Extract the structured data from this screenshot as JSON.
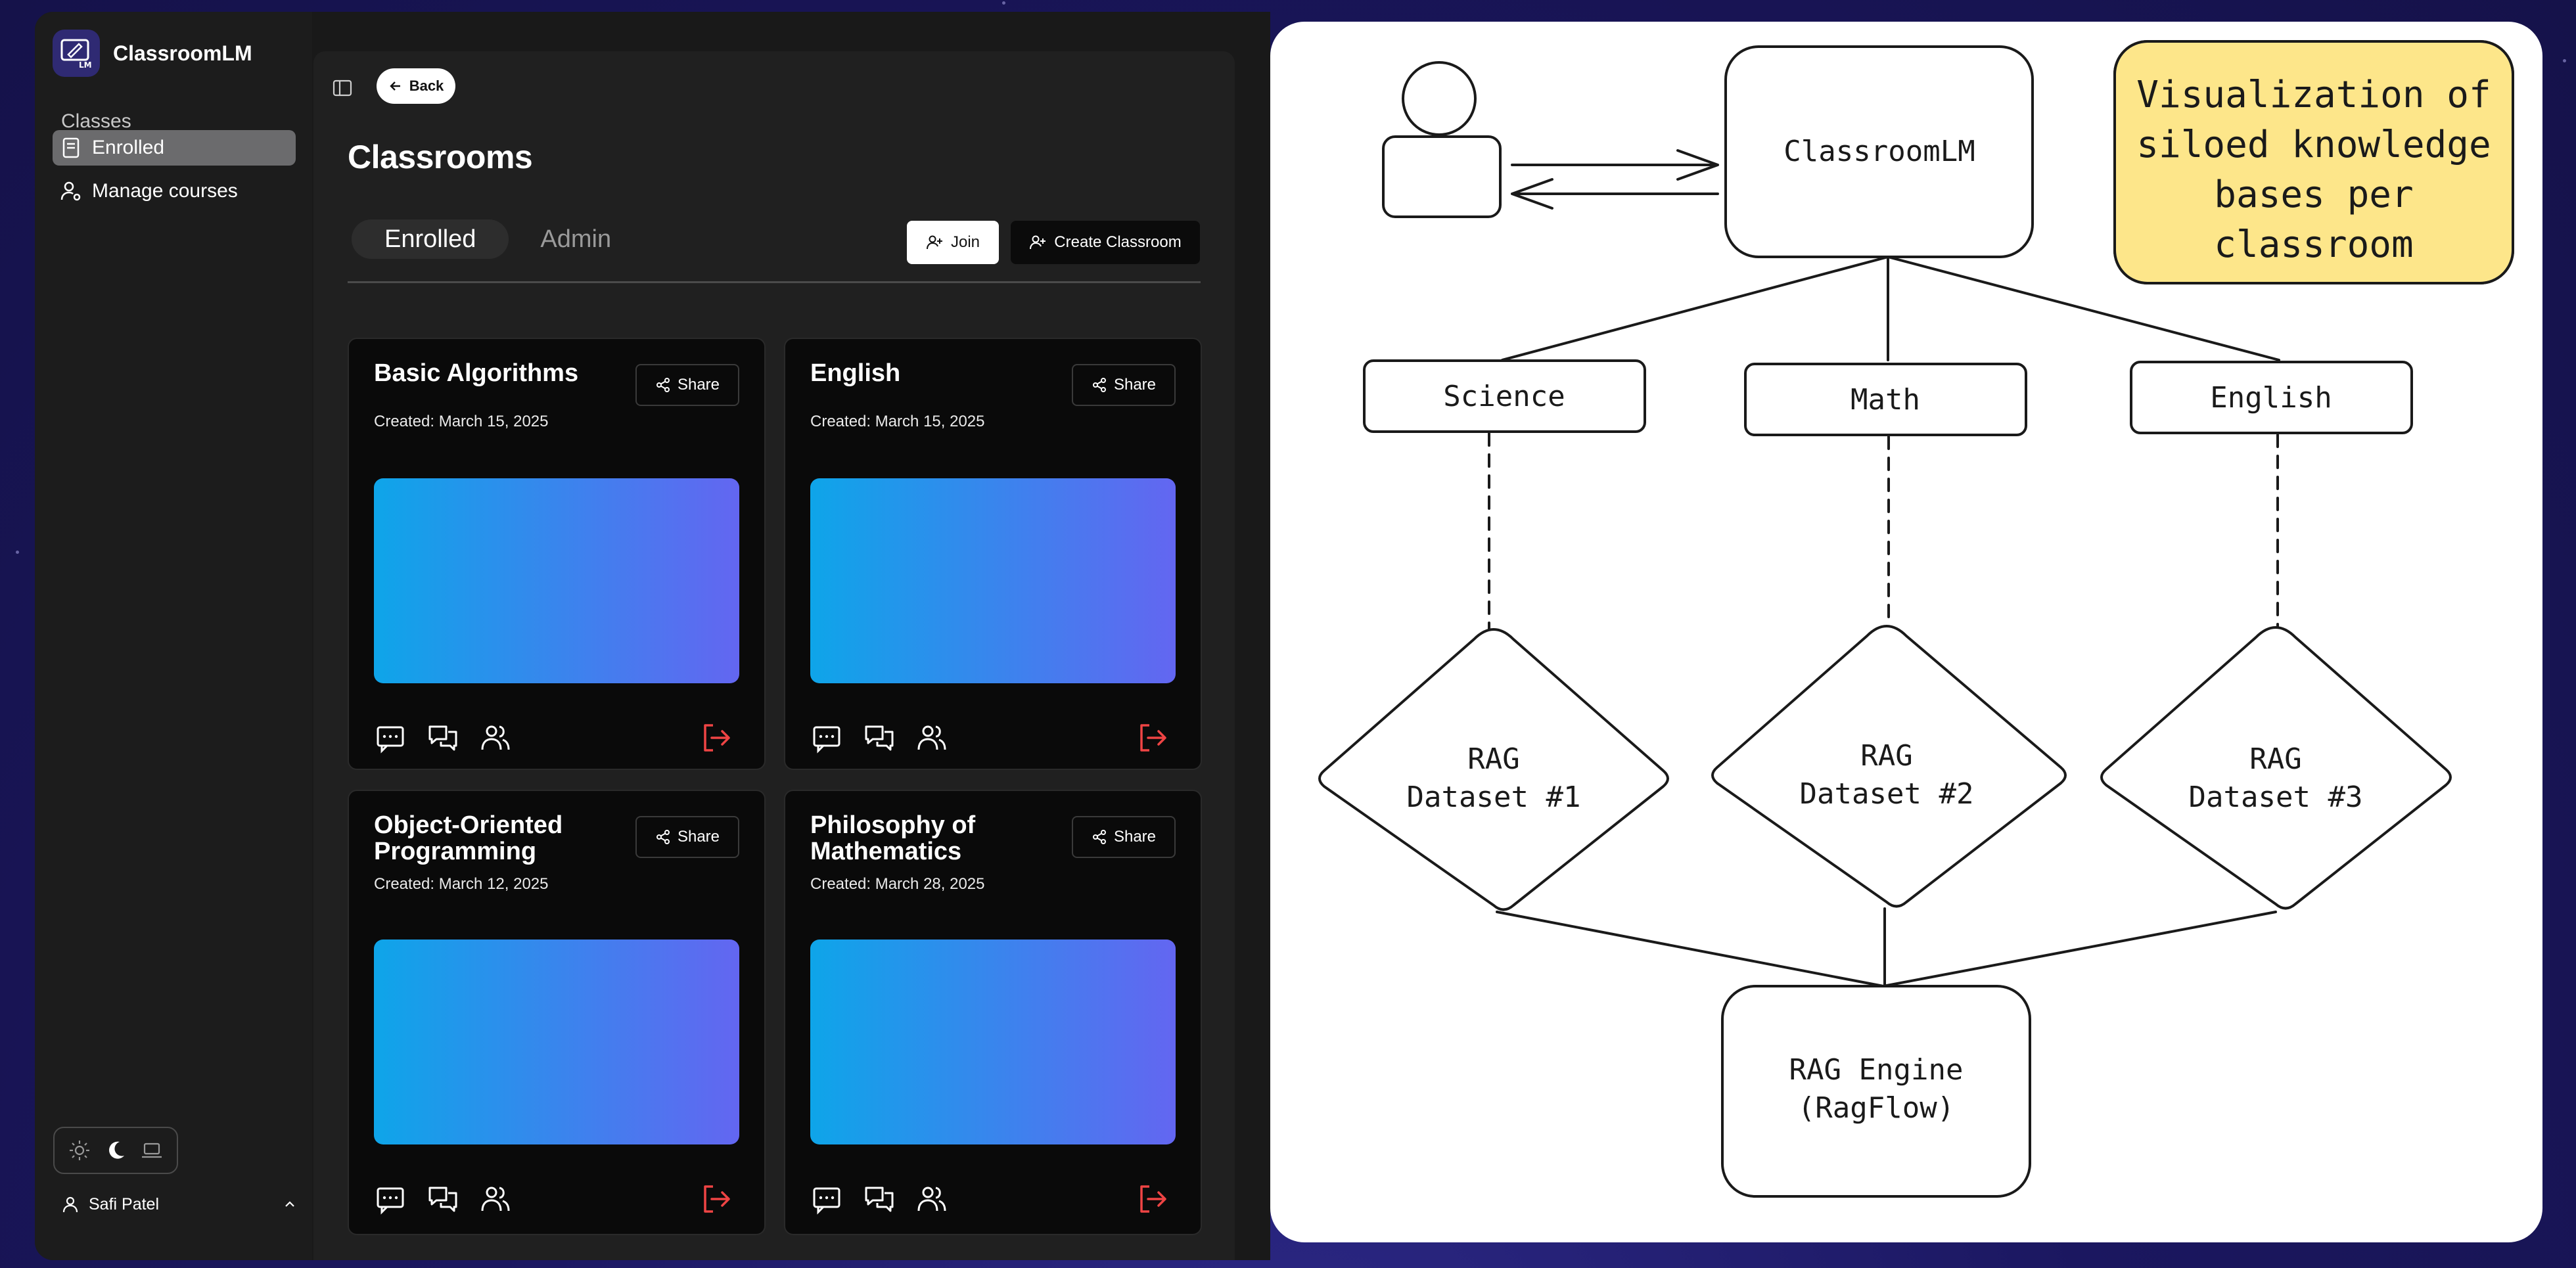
{
  "app": {
    "name": "ClassroomLM",
    "logo_text": "LM"
  },
  "sidebar": {
    "section_heading": "Classes",
    "items": [
      {
        "label": "Enrolled",
        "icon": "book-icon",
        "active": true
      },
      {
        "label": "Manage courses",
        "icon": "user-gear-icon",
        "active": false
      }
    ],
    "theme_options": [
      "sun-icon",
      "moon-icon",
      "laptop-icon"
    ],
    "theme_selected": "moon-icon",
    "user_name": "Safi Patel"
  },
  "main": {
    "back_label": "Back",
    "page_title": "Classrooms",
    "tabs": [
      {
        "label": "Enrolled",
        "active": true
      },
      {
        "label": "Admin",
        "active": false
      }
    ],
    "join_label": "Join",
    "create_label": "Create Classroom",
    "cards": [
      {
        "title": "Basic Algorithms",
        "date": "Created: March 15, 2025",
        "share_label": "Share"
      },
      {
        "title": "English",
        "date": "Created: March 15, 2025",
        "share_label": "Share"
      },
      {
        "title": "Object-Oriented Programming",
        "date": "Created: March 12, 2025",
        "share_label": "Share"
      },
      {
        "title": "Philosophy of Mathematics",
        "date": "Created: March 28, 2025",
        "share_label": "Share"
      }
    ],
    "banner_gradient": [
      "#0ea5e9",
      "#6366f1"
    ],
    "leave_color": "#ef4444"
  },
  "diagram": {
    "root": "ClassroomLM",
    "note": [
      "Visualization of",
      "siloed knowledge",
      "bases per",
      "classroom"
    ],
    "note_color": "#fde68a",
    "subjects": [
      "Science",
      "Math",
      "English"
    ],
    "datasets": [
      [
        "RAG",
        "Dataset #1"
      ],
      [
        "RAG",
        "Dataset #2"
      ],
      [
        "RAG",
        "Dataset #3"
      ]
    ],
    "engine": [
      "RAG Engine",
      "(RagFlow)"
    ]
  }
}
